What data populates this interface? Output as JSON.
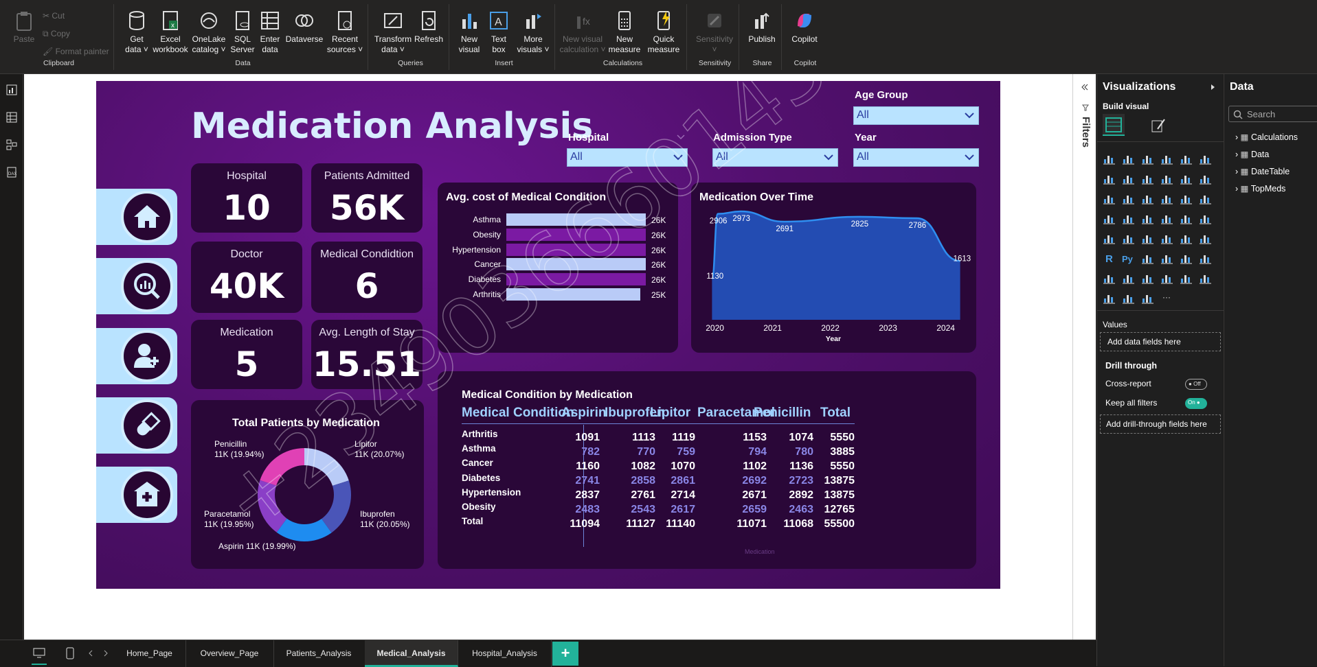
{
  "ribbon": {
    "clipboard": {
      "paste": "Paste",
      "cut": "Cut",
      "copy": "Copy",
      "format_painter": "Format painter",
      "group": "Clipboard"
    },
    "data": {
      "get_data": "Get data",
      "excel": "Excel workbook",
      "onelake": "OneLake catalog",
      "sql": "SQL Server",
      "enter": "Enter data",
      "dataverse": "Dataverse",
      "recent": "Recent sources",
      "group": "Data"
    },
    "queries": {
      "transform": "Transform data",
      "refresh": "Refresh",
      "group": "Queries"
    },
    "insert": {
      "new_visual": "New visual",
      "text_box": "Text box",
      "more_visuals": "More visuals",
      "group": "Insert"
    },
    "calculations": {
      "new_visual_calc": "New visual calculation",
      "new_measure": "New measure",
      "quick_measure": "Quick measure",
      "group": "Calculations"
    },
    "sensitivity": {
      "label": "Sensitivity",
      "group": "Sensitivity"
    },
    "share": {
      "publish": "Publish",
      "group": "Share"
    },
    "copilot": {
      "label": "Copilot",
      "group": "Copilot"
    }
  },
  "report": {
    "title": "Medication Analysis",
    "kpis": [
      {
        "label": "Hospital",
        "value": "10"
      },
      {
        "label": "Patients Admitted",
        "value": "56K"
      },
      {
        "label": "Doctor",
        "value": "40K"
      },
      {
        "label": "Medical Condidtion",
        "value": "6"
      },
      {
        "label": "Medication",
        "value": "5"
      },
      {
        "label": "Avg. Length of Stay",
        "value": "15.51"
      }
    ],
    "slicers": [
      {
        "label": "Age Group",
        "value": "All"
      },
      {
        "label": "Hospital",
        "value": "All"
      },
      {
        "label": "Admission Type",
        "value": "All"
      },
      {
        "label": "Year",
        "value": "All"
      }
    ],
    "watermark": "+2349036660143"
  },
  "chart_data": [
    {
      "type": "bar",
      "title": "Avg. cost of Medical Condition",
      "categories": [
        "Asthma",
        "Obesity",
        "Hypertension",
        "Cancer",
        "Diabetes",
        "Arthritis"
      ],
      "values": [
        26000,
        26000,
        26000,
        26000,
        26000,
        25000
      ],
      "value_labels": [
        "26K",
        "26K",
        "26K",
        "26K",
        "26K",
        "25K"
      ],
      "colors": [
        "#b9cbf7",
        "#7b1aa3",
        "#7b1aa3",
        "#b9cbf7",
        "#7b1aa3",
        "#b9cbf7"
      ]
    },
    {
      "type": "area",
      "title": "Medication Over Time",
      "xlabel": "Year",
      "x_ticks": [
        "2020",
        "2021",
        "2022",
        "2023",
        "2024"
      ],
      "annotated_points": [
        {
          "label": "1130",
          "x": 2019.95,
          "y": 1130
        },
        {
          "label": "2906",
          "x": 2020.05,
          "y": 2906
        },
        {
          "label": "2973",
          "x": 2020.45,
          "y": 2973
        },
        {
          "label": "2691",
          "x": 2021.2,
          "y": 2691
        },
        {
          "label": "2825",
          "x": 2022.5,
          "y": 2825
        },
        {
          "label": "2786",
          "x": 2023.5,
          "y": 2786
        },
        {
          "label": "1613",
          "x": 2024.25,
          "y": 1613
        }
      ],
      "ylim": [
        0,
        3200
      ]
    },
    {
      "type": "pie",
      "title": "Total Patients by Medication",
      "slices": [
        {
          "name": "Lipitor",
          "value": 20.07,
          "label": "Lipitor\n11K (20.07%)",
          "color": "#b9cbf7"
        },
        {
          "name": "Ibuprofen",
          "value": 20.05,
          "label": "Ibuprofen\n11K (20.05%)",
          "color": "#4a55b8"
        },
        {
          "name": "Aspirin",
          "value": 19.99,
          "label": "Aspirin 11K (19.99%)",
          "color": "#1e8cf0"
        },
        {
          "name": "Paracetamol",
          "value": 19.95,
          "label": "Paracetamol\n11K (19.95%)",
          "color": "#8a3fc7"
        },
        {
          "name": "Penicillin",
          "value": 19.94,
          "label": "Penicillin\n11K (19.94%)",
          "color": "#e041b5"
        }
      ]
    },
    {
      "type": "table",
      "title": "Medical Condition by Medication",
      "columns": [
        "Medical Condition",
        "Aspirin",
        "Ibuprofen",
        "Lipitor",
        "Paracetamol",
        "Penicillin",
        "Total"
      ],
      "rows": [
        [
          "Arthritis",
          "1091",
          "1113",
          "1119",
          "1153",
          "1074",
          "5550"
        ],
        [
          "Asthma",
          "782",
          "770",
          "759",
          "794",
          "780",
          "3885"
        ],
        [
          "Cancer",
          "1160",
          "1082",
          "1070",
          "1102",
          "1136",
          "5550"
        ],
        [
          "Diabetes",
          "2741",
          "2858",
          "2861",
          "2692",
          "2723",
          "13875"
        ],
        [
          "Hypertension",
          "2837",
          "2761",
          "2714",
          "2671",
          "2892",
          "13875"
        ],
        [
          "Obesity",
          "2483",
          "2543",
          "2617",
          "2659",
          "2463",
          "12765"
        ],
        [
          "Total",
          "11094",
          "11127",
          "11140",
          "11071",
          "11068",
          "55500"
        ]
      ],
      "footer_label": "Medication"
    }
  ],
  "filters": {
    "label": "Filters"
  },
  "visualizations": {
    "title": "Visualizations",
    "build": "Build visual",
    "values": "Values",
    "values_placeholder": "Add data fields here",
    "drill": "Drill through",
    "cross": "Cross-report",
    "cross_state": "Off",
    "keep": "Keep all filters",
    "keep_state": "On",
    "drill_placeholder": "Add drill-through fields here"
  },
  "data_pane": {
    "title": "Data",
    "search_placeholder": "Search",
    "tables": [
      "Calculations",
      "Data",
      "DateTable",
      "TopMeds"
    ]
  },
  "pages": [
    "Home_Page",
    "Overview_Page",
    "Patients_Analysis",
    "Medical_Analysis",
    "Hospital_Analysis"
  ],
  "active_page": "Medical_Analysis",
  "add_page": "+"
}
